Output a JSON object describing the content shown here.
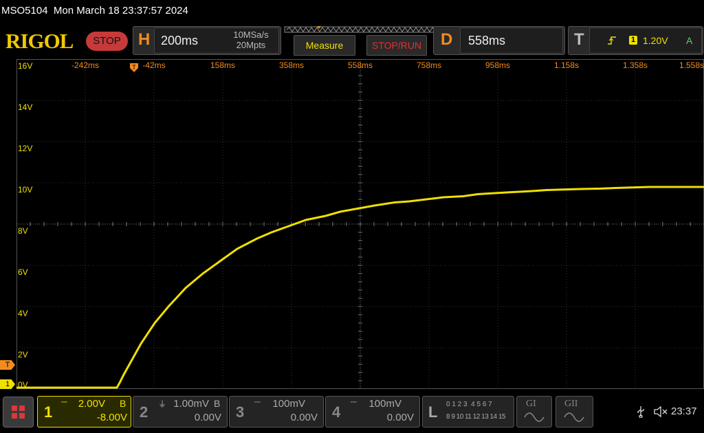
{
  "header": {
    "model": "MSO5104",
    "datetime": "Mon March 18 23:37:57 2024"
  },
  "toolbar": {
    "logo": "RIGOL",
    "run_state": "STOP",
    "horizontal": {
      "letter": "H",
      "timebase": "200ms",
      "sample_rate": "10MSa/s",
      "memory_depth": "20Mpts"
    },
    "measure_label": "Measure",
    "stop_run_label": "STOP/RUN",
    "delay": {
      "letter": "D",
      "value": "558ms"
    },
    "trigger": {
      "letter": "T",
      "channel": "1",
      "level": "1.20V",
      "mode": "A"
    }
  },
  "screen": {
    "time_labels": [
      "-242ms",
      "-42ms",
      "158ms",
      "358ms",
      "558ms",
      "758ms",
      "958ms",
      "1.158s",
      "1.358s",
      "1.558s"
    ],
    "voltage_labels": [
      "16V",
      "14V",
      "12V",
      "10V",
      "8V",
      "6V",
      "4V",
      "2V",
      "0V"
    ],
    "trigger_marker": "T",
    "channel_marker": "1"
  },
  "chart_data": {
    "type": "line",
    "x": [
      -0.342,
      -0.05,
      -0.042,
      -0.03,
      -0.01,
      0.02,
      0.06,
      0.1,
      0.15,
      0.2,
      0.25,
      0.3,
      0.358,
      0.4,
      0.45,
      0.5,
      0.558,
      0.6,
      0.65,
      0.7,
      0.758,
      0.8,
      0.9,
      0.958,
      1.0,
      1.1,
      1.158,
      1.2,
      1.3,
      1.358,
      1.4,
      1.5,
      1.558,
      1.658
    ],
    "y": [
      0.0,
      0.0,
      0.3,
      0.7,
      1.3,
      2.2,
      3.2,
      4.0,
      4.9,
      5.6,
      6.2,
      6.8,
      7.3,
      7.6,
      7.9,
      8.2,
      8.4,
      8.6,
      8.75,
      8.9,
      9.05,
      9.1,
      9.3,
      9.35,
      9.45,
      9.55,
      9.6,
      9.65,
      9.7,
      9.72,
      9.75,
      9.8,
      9.8,
      9.8
    ],
    "xlim": [
      -0.342,
      1.658
    ],
    "ylim": [
      0,
      16
    ],
    "grid": true,
    "trace_color": "#f0e000"
  },
  "bottom": {
    "ch1": {
      "num": "1",
      "scale": "2.00V",
      "bw": "B",
      "offset": "-8.00V"
    },
    "ch2": {
      "num": "2",
      "scale": "1.00mV",
      "bw": "B",
      "offset": "0.00V"
    },
    "ch3": {
      "num": "3",
      "scale": "100mV",
      "offset": "0.00V"
    },
    "ch4": {
      "num": "4",
      "scale": "100mV",
      "offset": "0.00V"
    },
    "logic": {
      "letter": "L",
      "row1": "0 1 2 3  4 5 6 7",
      "row2": "8 9 10 11 12 13 14 15"
    },
    "g1": "GI",
    "g2": "GII",
    "clock": "23:37"
  }
}
